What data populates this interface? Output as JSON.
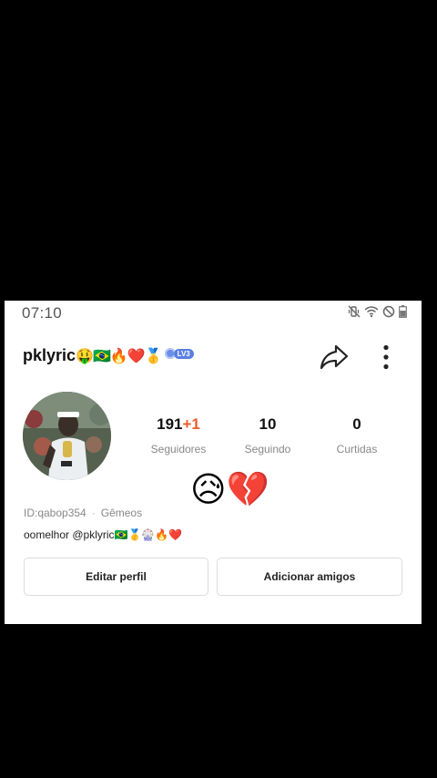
{
  "status_bar": {
    "time": "07:10",
    "icons": [
      "mute-vibrate-icon",
      "wifi-icon",
      "do-not-disturb-icon",
      "battery-icon"
    ]
  },
  "profile": {
    "username": "pklyric",
    "username_emojis": "🤑🇧🇷🔥❤️🥇",
    "level_badge": "LV3",
    "id_text": "ID:qabop354",
    "separator": "·",
    "zodiac": "Gêmeos",
    "bio": "oomelhor @pklyric🇧🇷🥇🎡🔥❤️",
    "mood_emojis": "😥💔"
  },
  "stats": {
    "followers_value": "191",
    "followers_increase": "+1",
    "followers_label": "Seguidores",
    "following_value": "10",
    "following_label": "Seguindo",
    "likes_value": "0",
    "likes_label": "Curtidas"
  },
  "actions": {
    "edit_profile_label": "Editar perfil",
    "add_friends_label": "Adicionar amigos"
  }
}
